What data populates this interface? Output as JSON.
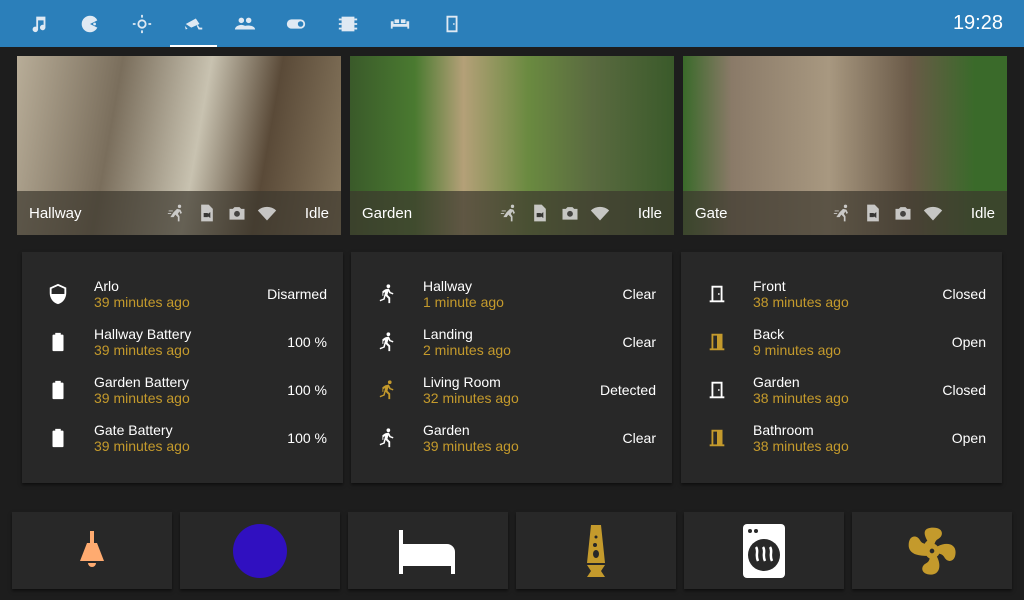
{
  "header": {
    "time": "19:28",
    "tabs": [
      "music",
      "pacman",
      "brightness",
      "cctv",
      "people",
      "toggle",
      "memory",
      "sofa",
      "door"
    ],
    "active_tab": 3
  },
  "cameras": [
    {
      "name": "Hallway",
      "status": "Idle"
    },
    {
      "name": "Garden",
      "status": "Idle"
    },
    {
      "name": "Gate",
      "status": "Idle"
    }
  ],
  "cards": [
    [
      {
        "name": "Arlo",
        "time": "39 minutes ago",
        "state": "Disarmed",
        "icon": "shield"
      },
      {
        "name": "Hallway Battery",
        "time": "39 minutes ago",
        "state": "100 %",
        "icon": "battery"
      },
      {
        "name": "Garden Battery",
        "time": "39 minutes ago",
        "state": "100 %",
        "icon": "battery"
      },
      {
        "name": "Gate Battery",
        "time": "39 minutes ago",
        "state": "100 %",
        "icon": "battery"
      }
    ],
    [
      {
        "name": "Hallway",
        "time": "1 minute ago",
        "state": "Clear",
        "icon": "walk"
      },
      {
        "name": "Landing",
        "time": "2 minutes ago",
        "state": "Clear",
        "icon": "walk"
      },
      {
        "name": "Living Room",
        "time": "32 minutes ago",
        "state": "Detected",
        "icon": "run"
      },
      {
        "name": "Garden",
        "time": "39 minutes ago",
        "state": "Clear",
        "icon": "walk"
      }
    ],
    [
      {
        "name": "Front",
        "time": "38 minutes ago",
        "state": "Closed",
        "icon": "door-closed"
      },
      {
        "name": "Back",
        "time": "9 minutes ago",
        "state": "Open",
        "icon": "door-open"
      },
      {
        "name": "Garden",
        "time": "38 minutes ago",
        "state": "Closed",
        "icon": "door-closed"
      },
      {
        "name": "Bathroom",
        "time": "38 minutes ago",
        "state": "Open",
        "icon": "door-open"
      }
    ]
  ],
  "buttons": [
    "ceiling-light",
    "color-bulb",
    "bed",
    "lava-lamp",
    "tumble-dryer",
    "fan"
  ],
  "colors": {
    "accent": "#2b7fba",
    "secondary": "#c49a2c",
    "light": "#ffab70",
    "bulb": "#3010c0"
  }
}
